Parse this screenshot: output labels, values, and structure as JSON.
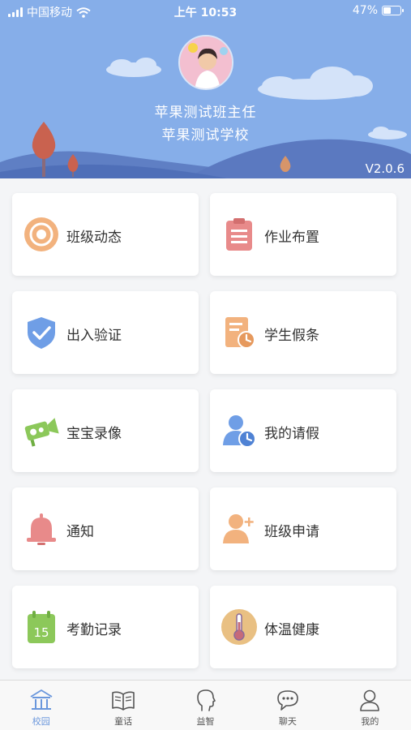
{
  "status_bar": {
    "carrier": "中国移动",
    "time": "上午 10:53",
    "battery": "47%",
    "battery_level": 0.47
  },
  "header": {
    "name": "苹果测试班主任",
    "school": "苹果测试学校",
    "version": "V2.0.6"
  },
  "menu": [
    {
      "label": "班级动态",
      "icon": "class-feed-icon"
    },
    {
      "label": "作业布置",
      "icon": "homework-icon"
    },
    {
      "label": "出入验证",
      "icon": "shield-check-icon"
    },
    {
      "label": "学生假条",
      "icon": "leave-note-icon"
    },
    {
      "label": "宝宝录像",
      "icon": "camera-icon"
    },
    {
      "label": "我的请假",
      "icon": "user-clock-icon"
    },
    {
      "label": "通知",
      "icon": "bell-icon"
    },
    {
      "label": "班级申请",
      "icon": "add-user-icon"
    },
    {
      "label": "考勤记录",
      "icon": "calendar-icon"
    },
    {
      "label": "体温健康",
      "icon": "thermometer-icon"
    }
  ],
  "calendar_day": "15",
  "tabs": [
    {
      "label": "校园",
      "icon": "campus-icon",
      "active": true
    },
    {
      "label": "童话",
      "icon": "book-icon",
      "active": false
    },
    {
      "label": "益智",
      "icon": "head-icon",
      "active": false
    },
    {
      "label": "聊天",
      "icon": "chat-icon",
      "active": false
    },
    {
      "label": "我的",
      "icon": "profile-icon",
      "active": false
    }
  ],
  "colors": {
    "header_bg": "#86aee9",
    "accent": "#6a97dc",
    "orange": "#f2b27e",
    "red": "#e88a8a",
    "blue": "#6f9ee6",
    "green": "#8cc85a"
  }
}
